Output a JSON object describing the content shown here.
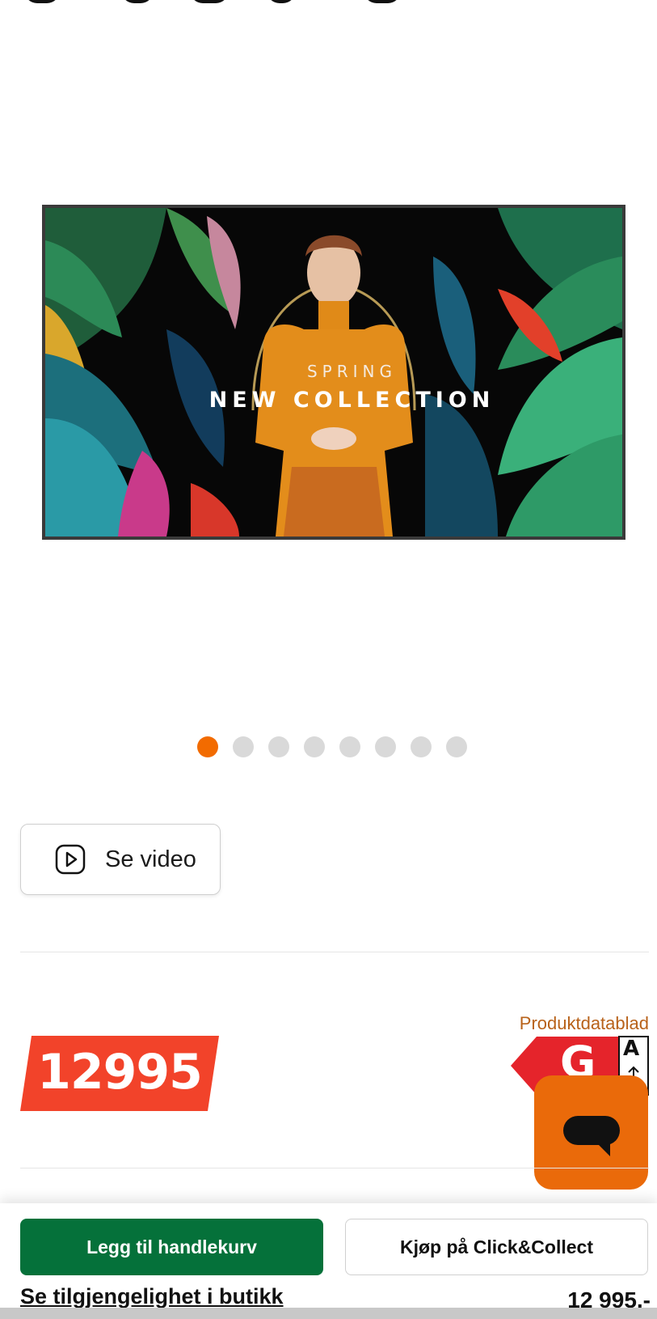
{
  "product_image": {
    "banner_small": "SPRING",
    "banner_large": "NEW COLLECTION",
    "slide_count": 8,
    "active_slide": 1
  },
  "video": {
    "label": "Se video",
    "icon": "play-circle-icon"
  },
  "price": {
    "badge_value": "12995",
    "badge_color": "#f2432a",
    "datasheet_label": "Produktdatablad",
    "energy_class": "G",
    "energy_scale_top": "A"
  },
  "chat": {
    "icon": "chat-bubble-icon",
    "color": "#ea6a0a"
  },
  "bottom_bar": {
    "add_to_cart_label": "Legg til handlekurv",
    "click_collect_label": "Kjøp på Click&Collect",
    "availability_label": "Se tilgjengelighet i butikk",
    "price_text": "12 995,-",
    "cart_color": "#05713a"
  }
}
